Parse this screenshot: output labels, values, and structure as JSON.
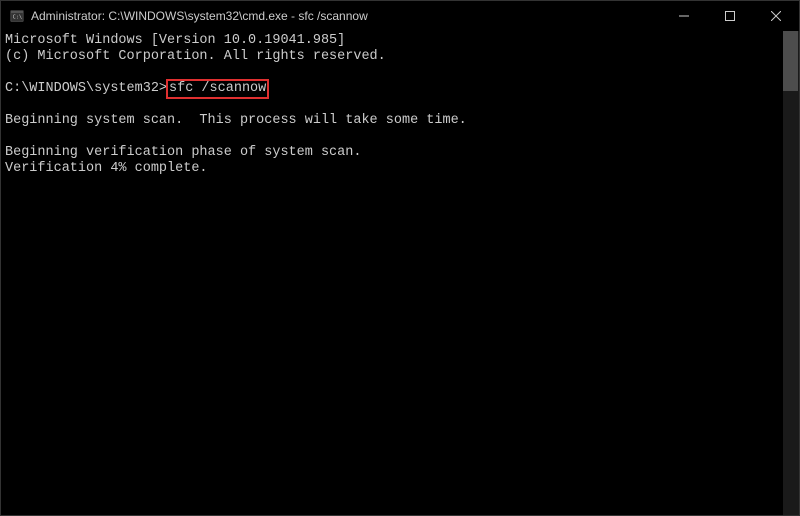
{
  "titlebar": {
    "title": "Administrator: C:\\WINDOWS\\system32\\cmd.exe - sfc  /scannow"
  },
  "terminal": {
    "line1": "Microsoft Windows [Version 10.0.19041.985]",
    "line2": "(c) Microsoft Corporation. All rights reserved.",
    "prompt": "C:\\WINDOWS\\system32>",
    "command": "sfc /scannow",
    "line3": "Beginning system scan.  This process will take some time.",
    "line4": "Beginning verification phase of system scan.",
    "line5": "Verification 4% complete."
  }
}
